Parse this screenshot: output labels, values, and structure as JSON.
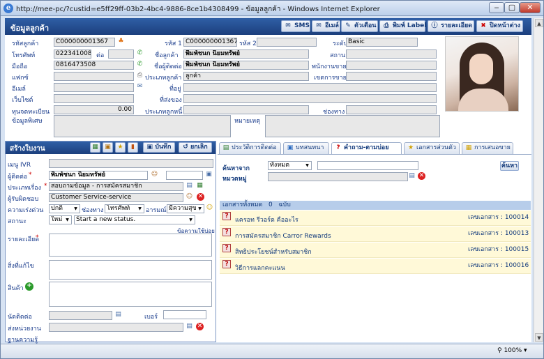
{
  "window": {
    "title": "http://mee-pc/?custid=e5ff29ff-03b2-4bc4-9886-8ce1b4308499 - ข้อมูลลูกค้า - Windows Internet Explorer",
    "min": "‒",
    "max": "▢",
    "close": "✕"
  },
  "header": {
    "title": "ข้อมูลลูกค้า",
    "buttons": {
      "sms": "SMS",
      "email": "อีเมล์",
      "reminder": "ตัวเตือน",
      "print": "พิมพ์ Label",
      "details": "รายละเอียด",
      "close": "ปิดหน้าต่าง"
    }
  },
  "customer": {
    "id_label": "รหัสลูกค้า",
    "id": "C000000001367",
    "code1_label": "รหัส 1",
    "code1": "C000000001367",
    "code2_label": "รหัส 2",
    "code2": "",
    "level_label": "ระดับ",
    "level": "Basic",
    "phone_label": "โทรศัพท์",
    "phone": "022341008",
    "ext_label": "ต่อ",
    "ext": "",
    "name_label": "ชื่อลูกค้า",
    "name": "พิมพ์ชนก นิยมทรัพย์",
    "status_label": "สถานะ",
    "status": "",
    "mobile_label": "มือถือ",
    "mobile": "0816473508",
    "contact_label": "ชื่อผู้ติดต่อ",
    "contact": "พิมพ์ชนก นิยมทรัพย์",
    "staff_label": "พนักงานขาย",
    "staff": "",
    "fax_label": "แฟกซ์",
    "fax": "",
    "type_label": "ประเภทลูกค้า",
    "type": "ลูกค้า",
    "area_label": "เขตการขาย",
    "area": "",
    "email_label": "อีเมล์",
    "email": "",
    "address_label": "ที่อยู่",
    "address": "",
    "website_label": "เว็บไซต์",
    "website": "",
    "shipping_label": "ที่ส่งของ",
    "shipping": "",
    "capital_label": "ทุนจดทะเบียน",
    "capital": "0.00",
    "debtor_label": "ประเภทลูกหนี้",
    "debtor": "",
    "channel_label": "ช่องทาง",
    "channel": "",
    "special_label": "ข้อมูลพิเศษ",
    "note_label": "หมายเหตุ"
  },
  "task": {
    "title": "สร้างใบงาน",
    "save": "บันทึก",
    "cancel": "ยกเลิก",
    "ivr_label": "เมนู IVR",
    "ivr": "",
    "contact_label": "ผู้ติดต่อ",
    "contact": "พิมพ์ชนก นิยมทรัพย์",
    "contact_extra": "",
    "type_label": "ประเภทเรื่อง",
    "type": "สอบถามข้อมูล - การสมัครสมาชิก",
    "owner_label": "ผู้รับผิดชอบ",
    "owner": "Customer Service-service",
    "urgency_label": "ความเร่งด่วน",
    "urgency": "ปกติ",
    "channel_label": "ช่องทาง",
    "channel": "โทรศัพท์",
    "mood_label": "อารมณ์",
    "mood": "มีความสุข",
    "status_label": "สถานะ",
    "status": "ใหม่",
    "status_text": "Start a new status.",
    "common_link": "ข้อความใช้บ่อย",
    "details_label": "รายละเอียด",
    "fix_label": "สิ่งที่แก้ไข",
    "product_label": "สินค้า",
    "appt_label": "นัดติดต่อ",
    "appt": "",
    "number_label": "เบอร์",
    "number": "",
    "forward_label": "ส่งหน่วยงาน",
    "forward": "",
    "kb_label": "ฐานความรู้"
  },
  "tabs": [
    {
      "label": "ประวัติการติดต่อ",
      "icon": "history-icon"
    },
    {
      "label": "บทสนทนา",
      "icon": "script-icon"
    },
    {
      "label": "คำถาม-ตามบ่อย",
      "icon": "faq-icon"
    },
    {
      "label": "เอกสารส่วนตัว",
      "icon": "doc-icon"
    },
    {
      "label": "การเสนอขาย",
      "icon": "offer-icon"
    }
  ],
  "faq": {
    "search_label": "ค้นหาจาก",
    "search_scope": "ทั้งหมด",
    "search_text": "",
    "search_button": "ค้นหา",
    "category_label": "หมวดหมู่",
    "category": "",
    "total_label": "เอกสารทั้งหมด",
    "total": "0",
    "unit": "ฉบับ",
    "doc_label": "เลขเอกสาร :",
    "items": [
      {
        "title": "แครอท รีวอร์ด คืออะไร",
        "num": "100014"
      },
      {
        "title": "การสมัครสมาชิก Carror Rewards",
        "num": "100013"
      },
      {
        "title": "สิทธิประโยชน์สำหรับสมาชิก",
        "num": "100015"
      },
      {
        "title": "วิธีการแลกคะแนน",
        "num": "100016"
      }
    ]
  },
  "status": {
    "zoom": "100%"
  }
}
